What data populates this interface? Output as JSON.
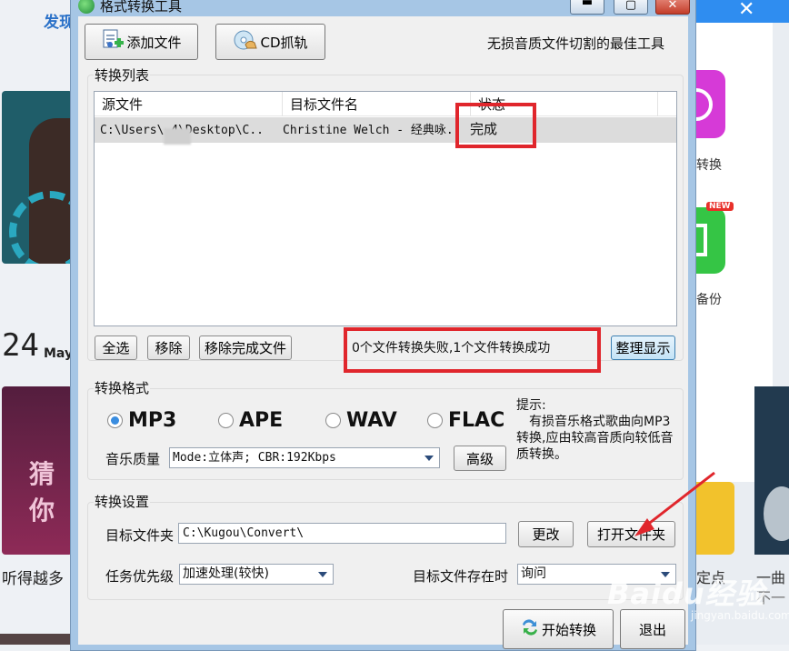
{
  "background": {
    "discover_link": "发现",
    "date_num": "24",
    "date_month": "May",
    "banner_text": "猜你",
    "left_caption": "听得越多",
    "right_label_1": "转换",
    "right_label_2": "备份",
    "new_badge": "NEW",
    "right_caption_1": "定点",
    "right_caption_2": "一曲",
    "right_caption_3": "不一"
  },
  "window": {
    "title": "格式转换工具",
    "min_glyph": "▬",
    "max_glyph": "▢",
    "close_glyph": "✕"
  },
  "toolbar": {
    "add_file": "添加文件",
    "cd_rip": "CD抓轨",
    "slogan": "无损音质文件切割的最佳工具"
  },
  "list": {
    "group_title": "转换列表",
    "columns": [
      "源文件",
      "目标文件名",
      "状态"
    ],
    "rows": [
      {
        "source": "C:\\Users\\   4\\Desktop\\C..",
        "target": "Christine Welch - 经典咏..",
        "status": "完成"
      }
    ]
  },
  "list_actions": {
    "select_all": "全选",
    "remove": "移除",
    "remove_done": "移除完成文件",
    "status_message": "0个文件转换失败,1个文件转换成功",
    "tidy": "整理显示"
  },
  "format": {
    "group_title": "转换格式",
    "options": [
      "MP3",
      "APE",
      "WAV",
      "FLAC"
    ],
    "selected": "MP3",
    "quality_label": "音乐质量",
    "quality_value": "Mode:立体声; CBR:192Kbps",
    "advanced": "高级",
    "hint_title": "提示:",
    "hint_body": "有损音乐格式歌曲向MP3转换,应由较高音质向较低音质转换。"
  },
  "settings": {
    "group_title": "转换设置",
    "target_folder_label": "目标文件夹",
    "target_folder_value": "C:\\Kugou\\Convert\\",
    "change": "更改",
    "open_folder": "打开文件夹",
    "priority_label": "任务优先级",
    "priority_value": "加速处理(较快)",
    "exists_label": "目标文件存在时",
    "exists_value": "询问"
  },
  "footer": {
    "start": "开始转换",
    "exit": "退出"
  },
  "watermark": {
    "brand": "Baidu经验",
    "sub": "jingyan.baidu.com"
  },
  "colors": {
    "highlight_red": "#e0262c",
    "radio_selected": "#3a8de0",
    "window_frame": "#a6c6e5"
  }
}
